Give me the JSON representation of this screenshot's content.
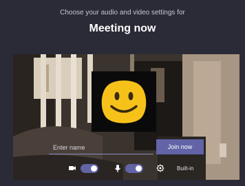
{
  "header": {
    "subtitle": "Choose your audio and video settings for",
    "title": "Meeting now"
  },
  "preview": {
    "name_input": {
      "placeholder": "Enter name",
      "value": ""
    },
    "join_button_label": "Join now"
  },
  "controls": {
    "camera": {
      "icon": "video-camera-icon",
      "on": true
    },
    "microphone": {
      "icon": "microphone-icon",
      "on": true
    },
    "device_settings": {
      "icon": "gear-icon",
      "label": "Built-in"
    }
  },
  "colors": {
    "background": "#2b2a37",
    "accent": "#6264a7",
    "emoji_face": "#f6c21a"
  }
}
